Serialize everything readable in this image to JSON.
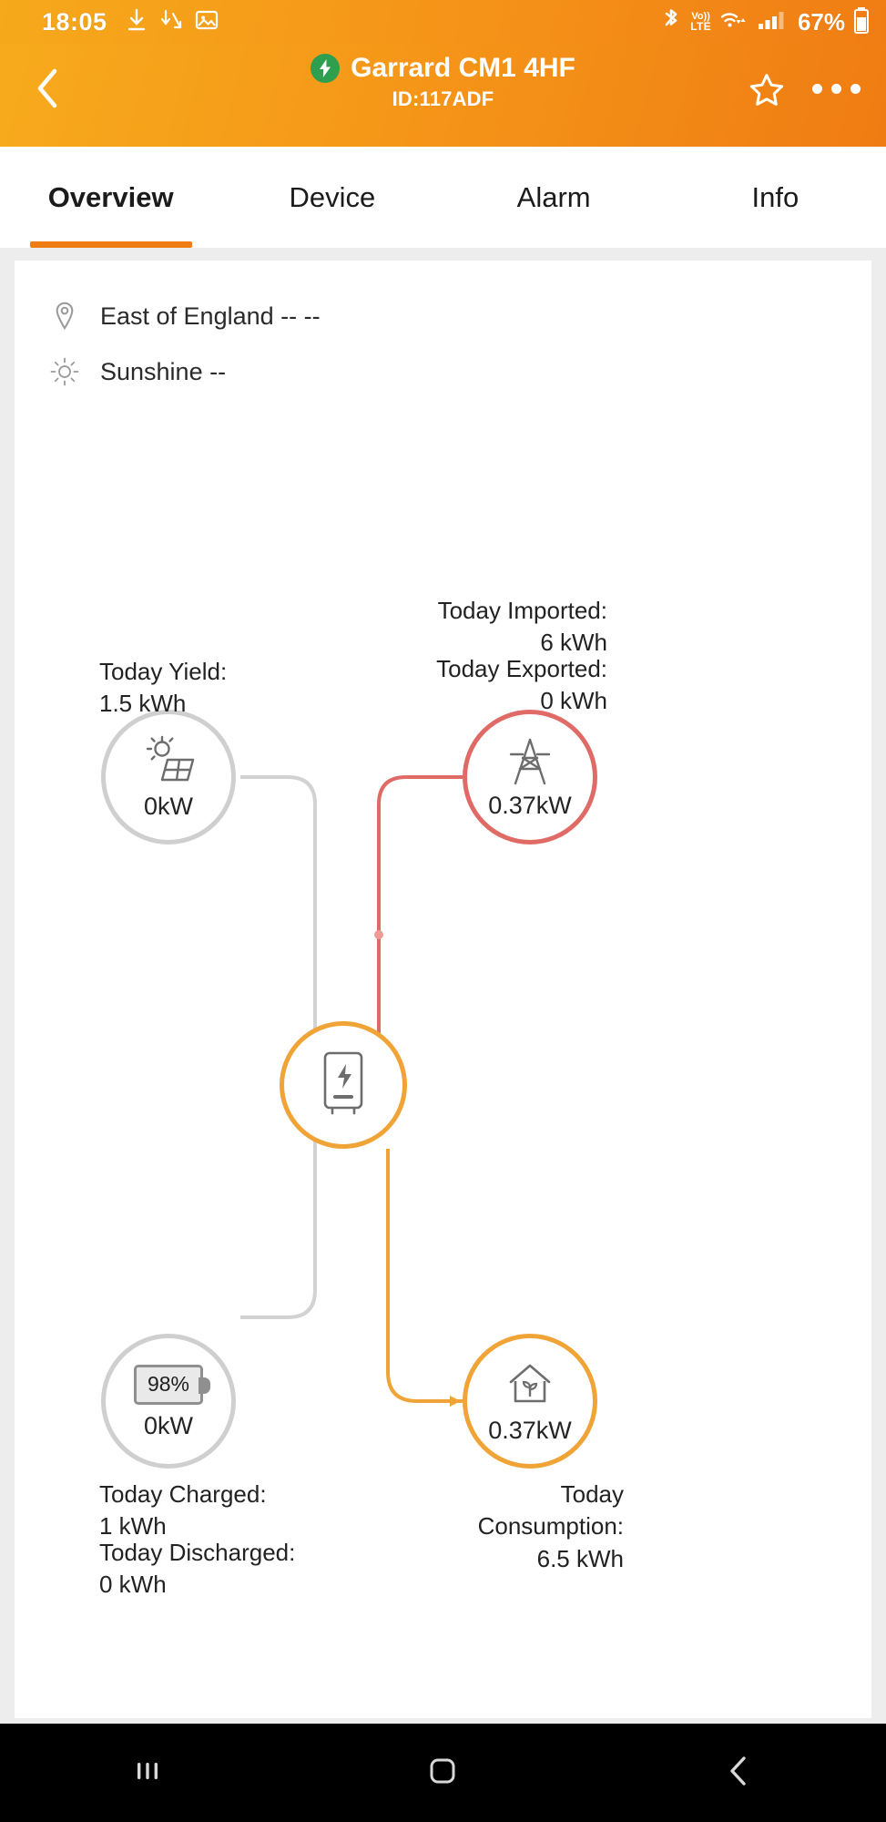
{
  "statusbar": {
    "time": "18:05",
    "battery_percent": "67%",
    "icons": [
      "download-icon",
      "download-arrow-icon",
      "image-icon",
      "bluetooth-icon",
      "volte-icon",
      "wifi-icon",
      "signal-icon",
      "battery-icon"
    ],
    "volte_line1": "Vo))",
    "volte_line2": "LTE"
  },
  "appbar": {
    "title": "Garrard CM1 4HF",
    "subtitle": "ID:117ADF",
    "back_icon": "back-chevron-icon",
    "status_icon": "lightning-bolt-icon",
    "favorite_icon": "star-outline-icon",
    "more_icon": "overflow-menu-icon"
  },
  "tabs": [
    {
      "label": "Overview",
      "active": true
    },
    {
      "label": "Device",
      "active": false
    },
    {
      "label": "Alarm",
      "active": false
    },
    {
      "label": "Info",
      "active": false
    }
  ],
  "meta": {
    "location_icon": "location-pin-icon",
    "location": "East of England -- --",
    "weather_icon": "sun-icon",
    "weather": "Sunshine  --"
  },
  "flow": {
    "pv": {
      "icon": "solar-panel-icon",
      "value": "0kW",
      "label_title": "Today Yield:",
      "label_value": "1.5 kWh",
      "ring_color": "#cfcfcf"
    },
    "grid": {
      "icon": "pylon-icon",
      "value": "0.37kW",
      "imported_title": "Today Imported:",
      "imported_value": "6 kWh",
      "exported_title": "Today Exported:",
      "exported_value": "0 kWh",
      "ring_color": "#e06b66"
    },
    "inverter": {
      "icon": "inverter-icon",
      "ring_color": "#f0a336"
    },
    "battery": {
      "icon": "battery-level-icon",
      "soc": "98%",
      "value": "0kW",
      "charged_title": "Today Charged:",
      "charged_value": "1 kWh",
      "discharged_title": "Today Discharged:",
      "discharged_value": "0 kWh",
      "ring_color": "#cfcfcf"
    },
    "home": {
      "icon": "home-icon",
      "value": "0.37kW",
      "consumption_title_line1": "Today",
      "consumption_title_line2": "Consumption:",
      "consumption_value": "6.5 kWh",
      "ring_color": "#f0a336"
    },
    "line_colors": {
      "idle": "#d2d2d2",
      "grid_import": "#e06b66",
      "load": "#f0a336"
    }
  },
  "labels": {
    "yield": "Today Yield:\n1.5 kWh",
    "imported": "Today Imported:\n6 kWh",
    "exported": "Today Exported:\n0 kWh",
    "charged": "Today Charged:\n1 kWh",
    "discharged": "Today Discharged:\n0 kWh",
    "consumption": "Today\nConsumption:\n6.5 kWh"
  },
  "navbar": {
    "recents_icon": "recents-icon",
    "home_icon": "home-square-icon",
    "back_icon": "back-chevron-icon"
  }
}
